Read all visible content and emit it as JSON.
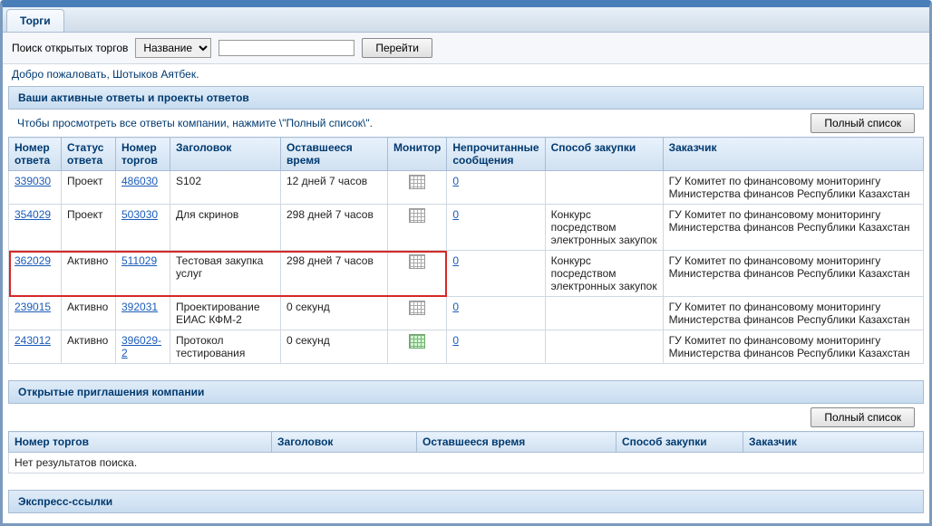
{
  "tabs": {
    "main": "Торги"
  },
  "search": {
    "label": "Поиск открытых торгов",
    "dropdown": "Название",
    "input_value": "",
    "go_btn": "Перейти"
  },
  "welcome": "Добро пожаловать, Шотыков Аятбек.",
  "section1": {
    "title": "Ваши активные ответы и проекты ответов",
    "hint": "Чтобы просмотреть все ответы компании, нажмите \\\"Полный список\\\".",
    "full_list_btn": "Полный список",
    "headers": {
      "resp_no": "Номер ответа",
      "resp_status": "Статус ответа",
      "auction_no": "Номер торгов",
      "title": "Заголовок",
      "remaining": "Оставшееся время",
      "monitor": "Монитор",
      "unread": "Непрочитанные сообщения",
      "method": "Способ закупки",
      "customer": "Заказчик"
    },
    "rows": [
      {
        "resp_no": "339030",
        "status": "Проект",
        "auction_no": "486030",
        "title": "S102",
        "remaining": "12 дней 7 часов",
        "unread": "0",
        "method": "",
        "customer": "ГУ Комитет по финансовому мониторингу Министерства финансов Республики Казахстан",
        "monitor": "normal"
      },
      {
        "resp_no": "354029",
        "status": "Проект",
        "auction_no": "503030",
        "title": "Для скринов",
        "remaining": "298 дней 7 часов",
        "unread": "0",
        "method": "Конкурс посредством электронных закупок",
        "customer": "ГУ Комитет по финансовому мониторингу Министерства финансов Республики Казахстан",
        "monitor": "normal"
      },
      {
        "resp_no": "362029",
        "status": "Активно",
        "auction_no": "511029",
        "title": "Тестовая закупка услуг",
        "remaining": "298 дней 7 часов",
        "unread": "0",
        "method": "Конкурс посредством электронных закупок",
        "customer": "ГУ Комитет по финансовому мониторингу Министерства финансов Республики Казахстан",
        "monitor": "normal",
        "highlight": true
      },
      {
        "resp_no": "239015",
        "status": "Активно",
        "auction_no": "392031",
        "title": "Проектирование ЕИАС КФМ-2",
        "remaining": "0 секунд",
        "unread": "0",
        "method": "",
        "customer": "ГУ Комитет по финансовому мониторингу Министерства финансов Республики Казахстан",
        "monitor": "normal"
      },
      {
        "resp_no": "243012",
        "status": "Активно",
        "auction_no": "396029-2",
        "title": "Протокол тестирования",
        "remaining": "0 секунд",
        "unread": "0",
        "method": "",
        "customer": "ГУ Комитет по финансовому мониторингу Министерства финансов Республики Казахстан",
        "monitor": "active"
      }
    ]
  },
  "section2": {
    "title": "Открытые приглашения компании",
    "full_list_btn": "Полный список",
    "headers": {
      "auction_no": "Номер торгов",
      "title": "Заголовок",
      "remaining": "Оставшееся время",
      "method": "Способ закупки",
      "customer": "Заказчик"
    },
    "empty": "Нет результатов поиска."
  },
  "section3": {
    "title": "Экспресс-ссылки"
  }
}
